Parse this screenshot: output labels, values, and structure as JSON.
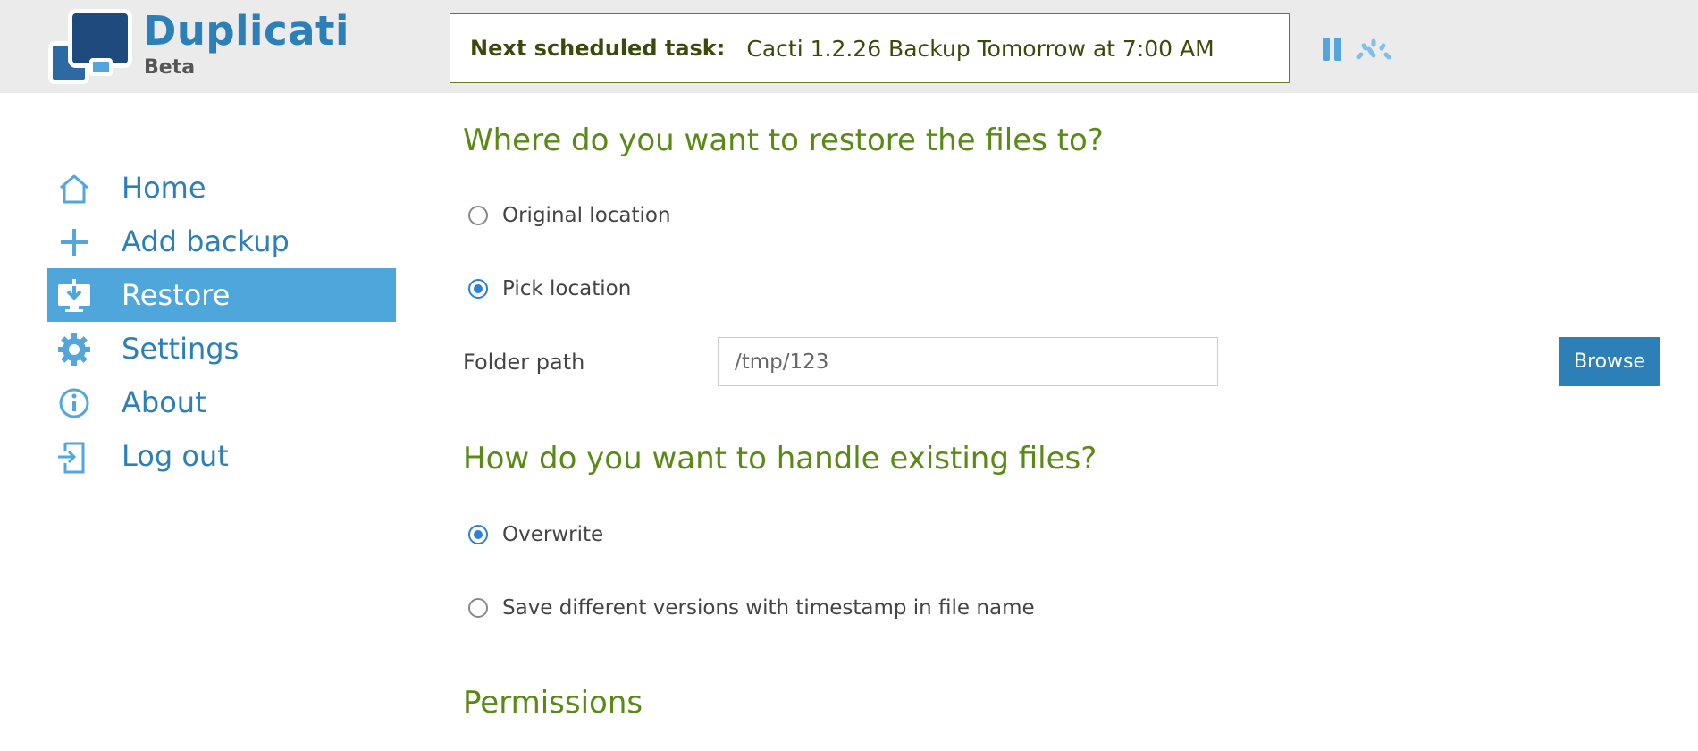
{
  "header": {
    "app_name": "Duplicati",
    "app_subtitle": "Beta",
    "task_label": "Next scheduled task:",
    "task_value": "Cacti 1.2.26 Backup Tomorrow at 7:00 AM",
    "icons": [
      "pause-icon",
      "throttle-speed-icon"
    ]
  },
  "sidebar": {
    "items": [
      {
        "label": "Home",
        "icon": "home-icon",
        "active": false
      },
      {
        "label": "Add backup",
        "icon": "plus-icon",
        "active": false
      },
      {
        "label": "Restore",
        "icon": "restore-monitor-icon",
        "active": true
      },
      {
        "label": "Settings",
        "icon": "gear-icon",
        "active": false
      },
      {
        "label": "About",
        "icon": "info-icon",
        "active": false
      },
      {
        "label": "Log out",
        "icon": "logout-icon",
        "active": false
      }
    ]
  },
  "main": {
    "restore_location": {
      "title": "Where do you want to restore the files to?",
      "options": [
        {
          "label": "Original location",
          "checked": false
        },
        {
          "label": "Pick location",
          "checked": true
        }
      ],
      "folder_label": "Folder path",
      "folder_value": "/tmp/123",
      "browse_label": "Browse"
    },
    "existing_files": {
      "title": "How do you want to handle existing files?",
      "options": [
        {
          "label": "Overwrite",
          "checked": true
        },
        {
          "label": "Save different versions with timestamp in file name",
          "checked": false
        }
      ]
    },
    "permissions": {
      "title": "Permissions"
    }
  },
  "colors": {
    "brand_blue": "#2d7fb8",
    "active_nav": "#4ea6da",
    "section_green": "#5a8a16",
    "task_border": "#6a7a1e"
  }
}
